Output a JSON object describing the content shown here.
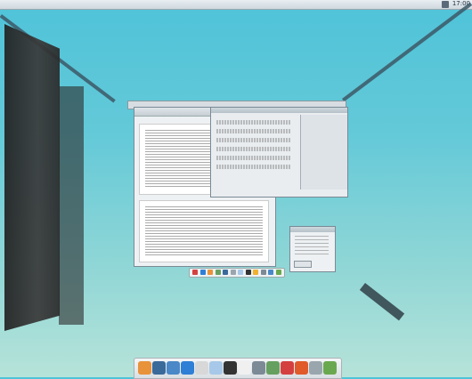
{
  "top_panel": {
    "clock": "17:00",
    "tray_icon": "network-icon"
  },
  "dock": {
    "icons": [
      {
        "name": "home-folder-icon",
        "color": "#e8923a"
      },
      {
        "name": "terminal-icon",
        "color": "#3a6a9a"
      },
      {
        "name": "file-manager-icon",
        "color": "#4a88c8"
      },
      {
        "name": "browser-icon",
        "color": "#2f7fd6"
      },
      {
        "name": "mail-icon",
        "color": "#d8d8d8"
      },
      {
        "name": "chat-icon",
        "color": "#a7c8e8"
      },
      {
        "name": "clapper-icon",
        "color": "#333333"
      },
      {
        "name": "text-editor-icon",
        "color": "#f0f0f0"
      },
      {
        "name": "presentation-icon",
        "color": "#7c8a96"
      },
      {
        "name": "calculator-icon",
        "color": "#66a060"
      },
      {
        "name": "shield-icon",
        "color": "#d44040"
      },
      {
        "name": "chart-icon",
        "color": "#e05a2a"
      },
      {
        "name": "disk-icon",
        "color": "#9aa6ae"
      },
      {
        "name": "settings-icon",
        "color": "#6aa84f"
      }
    ]
  },
  "mini_dock": {
    "colors": [
      "#d44040",
      "#2f7fd6",
      "#e8923a",
      "#66a060",
      "#3a6a9a",
      "#9aa6ae",
      "#a7c8e8",
      "#333333",
      "#f0b030",
      "#7c8a96",
      "#4a88c8",
      "#6aa84f"
    ]
  }
}
